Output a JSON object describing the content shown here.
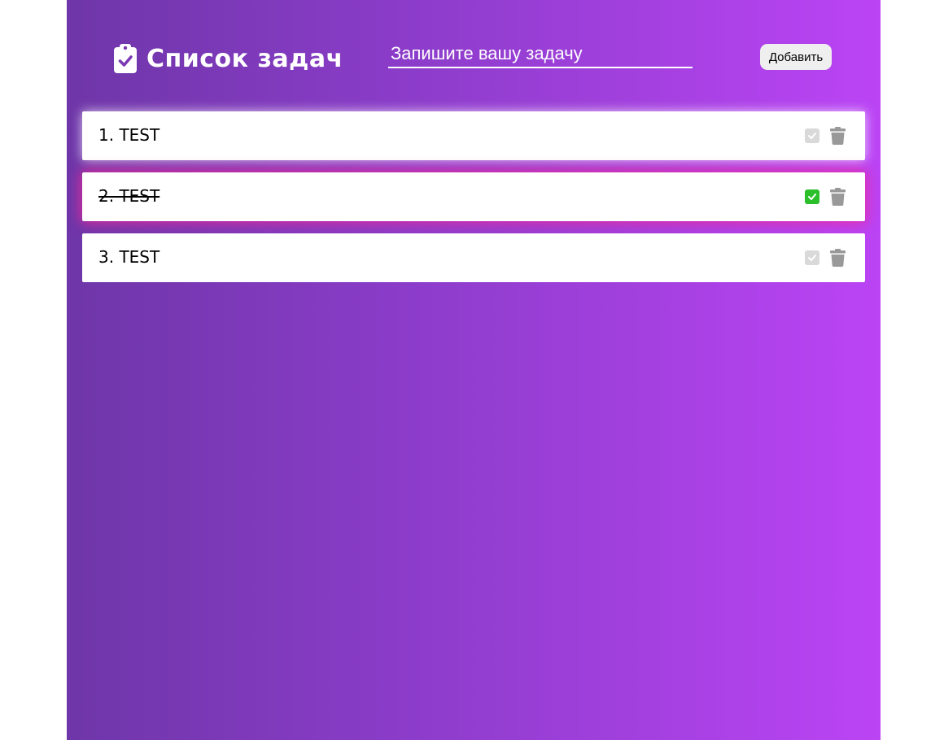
{
  "header": {
    "title": "Список задач",
    "icon": "clipboard-check-icon"
  },
  "input": {
    "placeholder": "Запишите вашу задачу",
    "value": ""
  },
  "add_button": {
    "label": "Добавить"
  },
  "tasks": [
    {
      "text": "1. TEST",
      "completed": false
    },
    {
      "text": "2. TEST",
      "completed": true
    },
    {
      "text": "3. TEST",
      "completed": false
    }
  ],
  "colors": {
    "gradient_start": "#6e36a8",
    "gradient_end": "#bb44f5",
    "check_active": "#2bc02b",
    "check_inactive": "#d9d9d9",
    "trash": "#999999",
    "completed_glow": "#f02896"
  }
}
